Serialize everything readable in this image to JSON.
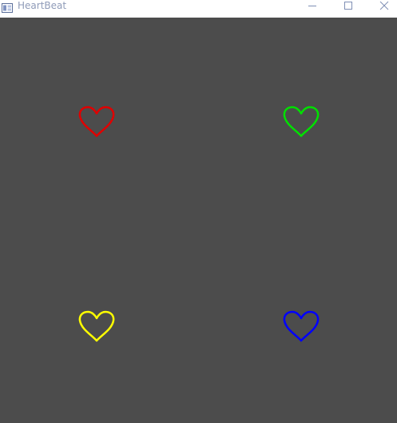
{
  "window": {
    "title": "HeartBeat"
  },
  "canvas": {
    "background": "#4c4c4c"
  },
  "hearts": [
    {
      "name": "heart-red",
      "color": "#e00000"
    },
    {
      "name": "heart-green",
      "color": "#00e000"
    },
    {
      "name": "heart-yellow",
      "color": "#ffff00"
    },
    {
      "name": "heart-blue",
      "color": "#0000ff"
    }
  ],
  "icons": {
    "app": "app-icon",
    "minimize": "minimize-icon",
    "maximize": "maximize-icon",
    "close": "close-icon"
  }
}
